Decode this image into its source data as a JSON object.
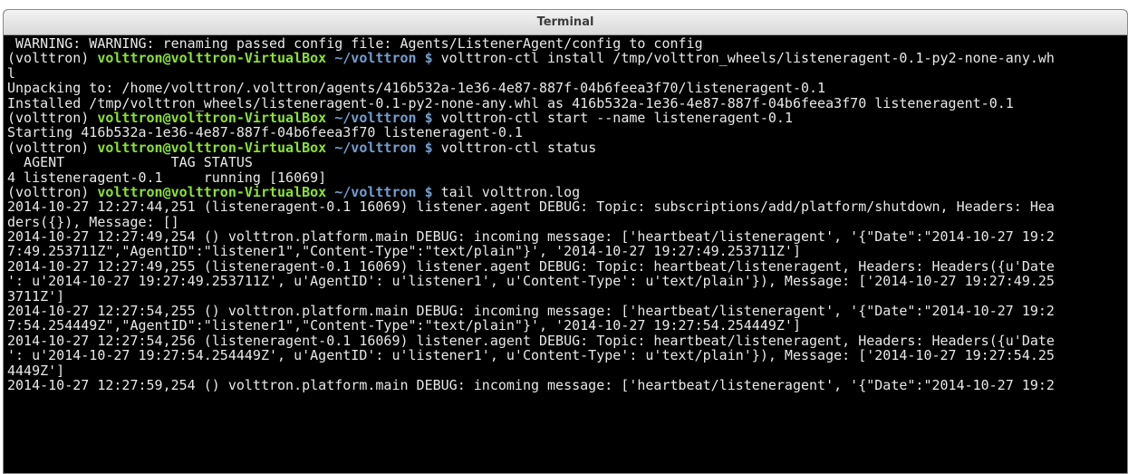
{
  "window": {
    "title": "Terminal"
  },
  "prompt": {
    "env": "(volttron) ",
    "user": "volttron@volttron-VirtualBox",
    "path": " ~/volttron",
    "symbol": " $ "
  },
  "lines": [
    {
      "type": "out",
      "text": " WARNING: WARNING: renaming passed config file: Agents/ListenerAgent/config to config"
    },
    {
      "type": "prompt",
      "cmd": "volttron-ctl install /tmp/volttron_wheels/listeneragent-0.1-py2-none-any.wh"
    },
    {
      "type": "out",
      "text": "l"
    },
    {
      "type": "out",
      "text": "Unpacking to: /home/volttron/.volttron/agents/416b532a-1e36-4e87-887f-04b6feea3f70/listeneragent-0.1"
    },
    {
      "type": "out",
      "text": "Installed /tmp/volttron_wheels/listeneragent-0.1-py2-none-any.whl as 416b532a-1e36-4e87-887f-04b6feea3f70 listeneragent-0.1"
    },
    {
      "type": "prompt",
      "cmd": "volttron-ctl start --name listeneragent-0.1"
    },
    {
      "type": "out",
      "text": "Starting 416b532a-1e36-4e87-887f-04b6feea3f70 listeneragent-0.1"
    },
    {
      "type": "prompt",
      "cmd": "volttron-ctl status"
    },
    {
      "type": "out",
      "text": "  AGENT             TAG STATUS"
    },
    {
      "type": "out",
      "text": "4 listeneragent-0.1     running [16069]"
    },
    {
      "type": "prompt",
      "cmd": "tail volttron.log"
    },
    {
      "type": "out",
      "text": "2014-10-27 12:27:44,251 (listeneragent-0.1 16069) listener.agent DEBUG: Topic: subscriptions/add/platform/shutdown, Headers: Hea"
    },
    {
      "type": "out",
      "text": "ders({}), Message: []"
    },
    {
      "type": "out",
      "text": "2014-10-27 12:27:49,254 () volttron.platform.main DEBUG: incoming message: ['heartbeat/listeneragent', '{\"Date\":\"2014-10-27 19:2"
    },
    {
      "type": "out",
      "text": "7:49.253711Z\",\"AgentID\":\"listener1\",\"Content-Type\":\"text/plain\"}', '2014-10-27 19:27:49.253711Z']"
    },
    {
      "type": "out",
      "text": "2014-10-27 12:27:49,255 (listeneragent-0.1 16069) listener.agent DEBUG: Topic: heartbeat/listeneragent, Headers: Headers({u'Date"
    },
    {
      "type": "out",
      "text": "': u'2014-10-27 19:27:49.253711Z', u'AgentID': u'listener1', u'Content-Type': u'text/plain'}), Message: ['2014-10-27 19:27:49.25"
    },
    {
      "type": "out",
      "text": "3711Z']"
    },
    {
      "type": "out",
      "text": "2014-10-27 12:27:54,255 () volttron.platform.main DEBUG: incoming message: ['heartbeat/listeneragent', '{\"Date\":\"2014-10-27 19:2"
    },
    {
      "type": "out",
      "text": "7:54.254449Z\",\"AgentID\":\"listener1\",\"Content-Type\":\"text/plain\"}', '2014-10-27 19:27:54.254449Z']"
    },
    {
      "type": "out",
      "text": "2014-10-27 12:27:54,256 (listeneragent-0.1 16069) listener.agent DEBUG: Topic: heartbeat/listeneragent, Headers: Headers({u'Date"
    },
    {
      "type": "out",
      "text": "': u'2014-10-27 19:27:54.254449Z', u'AgentID': u'listener1', u'Content-Type': u'text/plain'}), Message: ['2014-10-27 19:27:54.25"
    },
    {
      "type": "out",
      "text": "4449Z']"
    },
    {
      "type": "out",
      "text": "2014-10-27 12:27:59,254 () volttron.platform.main DEBUG: incoming message: ['heartbeat/listeneragent', '{\"Date\":\"2014-10-27 19:2"
    }
  ]
}
